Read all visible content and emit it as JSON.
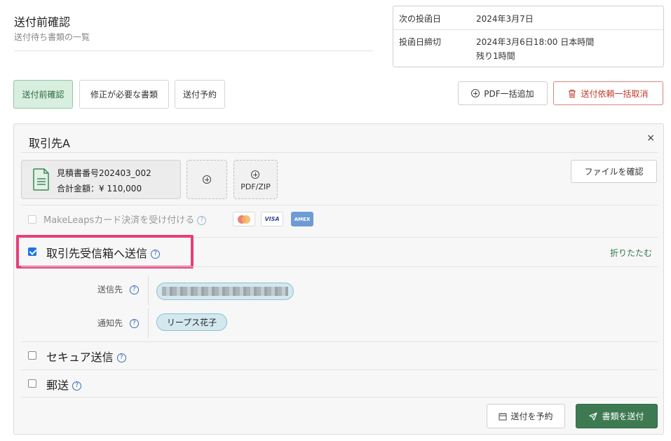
{
  "header": {
    "title": "送付前確認",
    "subtitle": "送付待ち書類の一覧"
  },
  "info": {
    "next_label": "次の投函日",
    "next_value": "2024年3月7日",
    "deadline_label": "投函日締切",
    "deadline_value": "2024年3月6日18:00 日本時間",
    "remaining": "残り1時間"
  },
  "tabs": [
    {
      "label": "送付前確認",
      "active": true
    },
    {
      "label": "修正が必要な書類",
      "active": false
    },
    {
      "label": "送付予約",
      "active": false
    }
  ],
  "actions": {
    "add_pdf": "PDF一括追加",
    "cancel_all": "送付依頼一括取消"
  },
  "panel": {
    "title": "取引先A",
    "close": "×",
    "document": {
      "name": "見積書番号202403_002",
      "amount": "合計金額：¥ 110,000"
    },
    "pdf_zip_label": "PDF/ZIP",
    "confirm_file": "ファイルを確認",
    "card_payment_label": "MakeLeapsカード決済を受け付ける",
    "card_logos": [
      "mastercard",
      "VISA",
      "AMEX"
    ],
    "inbox_label": "取引先受信箱へ送信",
    "collapse": "折りたたむ",
    "recipient_label": "送信先",
    "notify_label": "通知先",
    "notify_value": "リープス花子",
    "secure_label": "セキュア送信",
    "mail_label": "郵送",
    "schedule_button": "送付を予約",
    "send_button": "書類を送付"
  },
  "colors": {
    "accent_green": "#3d7a52",
    "tab_active_bg": "#d8eedf",
    "danger": "#c0392b",
    "highlight": "#e83e7a",
    "pill_bg": "#d3e8ef"
  }
}
